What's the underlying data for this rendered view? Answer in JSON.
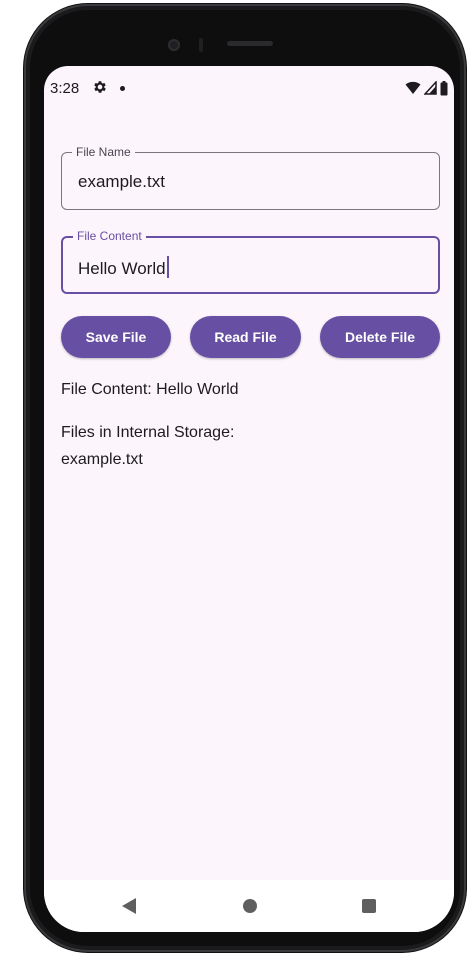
{
  "status_bar": {
    "time": "3:28",
    "icons": [
      "gear-icon",
      "notification-dot-icon",
      "wifi-icon",
      "cellular-signal-icon",
      "battery-icon"
    ]
  },
  "form": {
    "file_name": {
      "label": "File Name",
      "value": "example.txt"
    },
    "file_content": {
      "label": "File Content",
      "value": "Hello World",
      "focused": true
    }
  },
  "buttons": {
    "save": "Save File",
    "read": "Read File",
    "delete": "Delete File"
  },
  "output": {
    "file_content_text": "File Content: Hello World",
    "files_heading": "Files in Internal Storage:",
    "files": [
      "example.txt"
    ]
  },
  "nav_bar": {
    "icons": [
      "back-icon",
      "home-icon",
      "recents-icon"
    ]
  },
  "colors": {
    "primary": "#6750a4",
    "background": "#fcf5fc",
    "on_surface": "#1d1b20",
    "outline": "#7a757f"
  }
}
